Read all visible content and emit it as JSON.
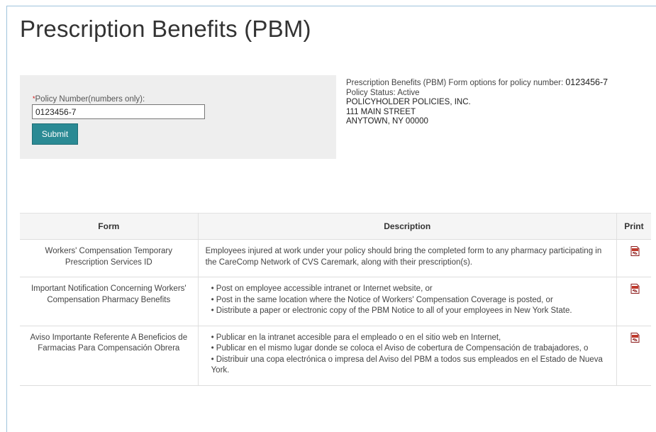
{
  "page": {
    "title": "Prescription Benefits (PBM)"
  },
  "form": {
    "policy_label_required": "*",
    "policy_label": "Policy Number(numbers only):",
    "policy_value": "0123456-7",
    "submit_label": "Submit"
  },
  "policy_info": {
    "options_text": "Prescription Benefits (PBM) Form options for policy number:",
    "policy_number": "0123456-7",
    "status": "Policy Status: Active",
    "company": "POLICYHOLDER POLICIES, INC.",
    "street": "111 MAIN STREET",
    "city": "ANYTOWN, NY 00000"
  },
  "table": {
    "headers": {
      "form": "Form",
      "description": "Description",
      "print": "Print"
    },
    "rows": [
      {
        "form": "Workers' Compensation Temporary Prescription Services ID",
        "description": [
          "Employees injured at work under your policy should bring the completed form to any pharmacy participating in the CareComp Network of CVS Caremark, along with their prescription(s)."
        ],
        "print_icon": "pdf-icon"
      },
      {
        "form": "Important Notification Concerning Workers' Compensation Pharmacy Benefits",
        "description": [
          "• Post on employee accessible intranet or Internet website, or",
          "• Post in the same location where the Notice of Workers' Compensation Coverage is posted, or",
          "• Distribute a paper or electronic copy of the PBM Notice to all of your employees in New York State."
        ],
        "print_icon": "pdf-icon"
      },
      {
        "form": "Aviso Importante Referente A Beneficios de Farmacias Para Compensación Obrera",
        "description": [
          "• Publicar en la intranet accesible para el empleado o en el sitio web en Internet,",
          "• Publicar en el mismo lugar donde se coloca el Aviso de cobertura de Compensación de trabajadores, o",
          "• Distribuir una copa electrónica o impresa del Aviso del PBM a todos sus empleados en el Estado de Nueva York."
        ],
        "print_icon": "pdf-icon"
      }
    ]
  },
  "colors": {
    "submit_bg": "#2b8a94",
    "panel_bg": "#eeeeee",
    "header_bg": "#f5f5f5",
    "pdf_icon": "#c0392b",
    "frame_border": "#9fc3dc"
  }
}
